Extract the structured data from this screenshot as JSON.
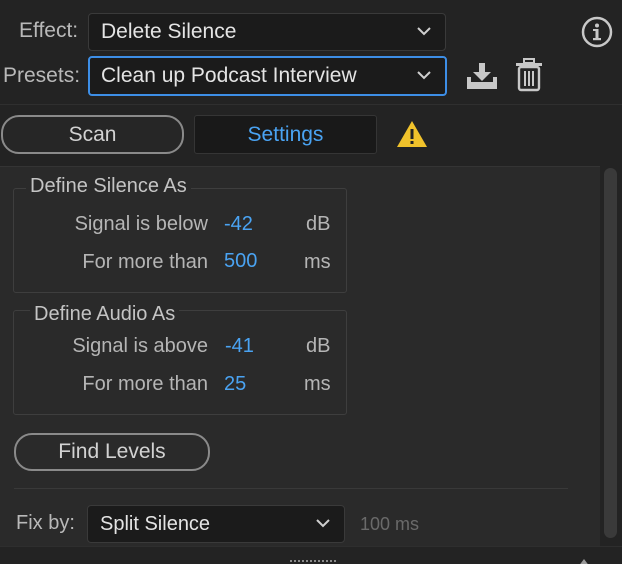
{
  "effect": {
    "label": "Effect:",
    "value": "Delete Silence"
  },
  "presets": {
    "label": "Presets:",
    "value": "Clean up Podcast Interview"
  },
  "tabs": {
    "scan_label": "Scan",
    "settings_label": "Settings"
  },
  "silence": {
    "title": "Define Silence As",
    "signal_label": "Signal is below",
    "signal_value": "-42",
    "signal_unit": "dB",
    "duration_label": "For more than",
    "duration_value": "500",
    "duration_unit": "ms"
  },
  "audio": {
    "title": "Define Audio As",
    "signal_label": "Signal is above",
    "signal_value": "-41",
    "signal_unit": "dB",
    "duration_label": "For more than",
    "duration_value": "25",
    "duration_unit": "ms"
  },
  "find_levels_label": "Find Levels",
  "fix_by": {
    "label": "Fix by:",
    "value": "Split Silence",
    "duration": "100 ms"
  },
  "colors": {
    "accent": "#4aa3f2",
    "focus": "#3d8ee6",
    "warning": "#f0c22b",
    "background": "#232323"
  },
  "icons": [
    "info-icon",
    "chevron-down-icon",
    "download-icon",
    "trash-icon",
    "warning-icon",
    "grip-icon",
    "scroll-up-icon"
  ]
}
